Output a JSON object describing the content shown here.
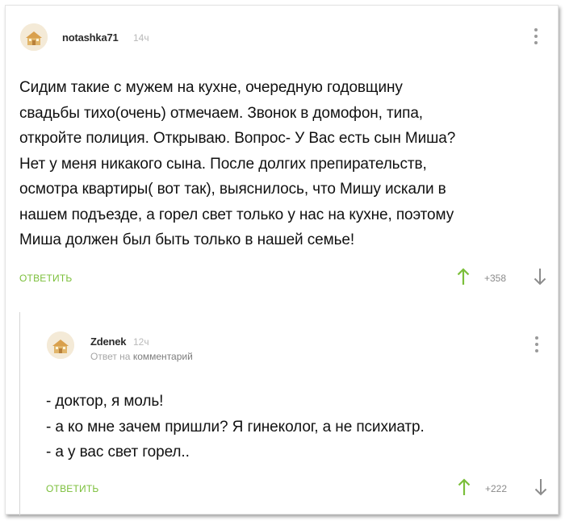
{
  "comments": [
    {
      "author": "notashka71",
      "time": "14ч",
      "lines": [
        "Сидим такие с мужем на кухне, очередную годовщину",
        "свадьбы тихо(очень) отмечаем. Звонок в домофон, типа,",
        "откройте полиция. Открываю. Вопрос- У Вас есть  сын Миша?",
        "Нет у меня никакого сына. После долгих препирательств,",
        "осмотра квартиры( вот так), выяснилось, что Мишу искали в",
        "нашем подъезде, а горел свет только у нас на кухне, поэтому",
        "Миша должен был быть только в нашей семье!"
      ],
      "reply_label": "ОТВЕТИТЬ",
      "score": "+358"
    },
    {
      "author": "Zdenek",
      "time": "12ч",
      "reply_to_prefix": "Ответ на",
      "reply_to_target": "комментарий",
      "lines": [
        "- доктор, я моль!",
        "- а ко мне зачем пришли? Я гинеколог, а не психиатр.",
        "- а у вас свет горел.."
      ],
      "reply_label": "ОТВЕТИТЬ",
      "score": "+222"
    }
  ],
  "colors": {
    "accent_green": "#7bbf3a",
    "upvote_green": "#7bbf3a",
    "downvote_gray": "#8c8c8c"
  },
  "icons": {
    "avatar": "default-avatar-icon",
    "menu": "more-vertical-icon",
    "upvote": "arrow-up-icon",
    "downvote": "arrow-down-icon"
  }
}
